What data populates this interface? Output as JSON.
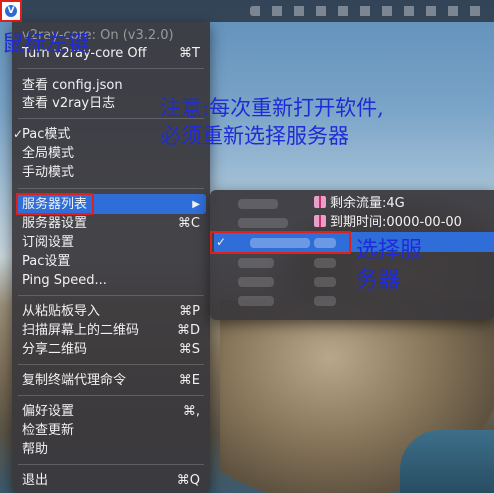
{
  "menubar": {
    "app_icon": "v2ray-app-icon"
  },
  "menu": {
    "header": "v2ray-core: On (v3.2.0)",
    "header_left": "v2ray-core: On",
    "version": "(v3.2.0)",
    "turn_off": "Turn v2ray-core Off",
    "turn_off_shortcut": "⌘T",
    "view_config": "查看 config.json",
    "view_log": "查看 v2ray日志",
    "pac_mode": "Pac模式",
    "global_mode": "全局模式",
    "manual_mode": "手动模式",
    "server_list": "服务器列表",
    "server_list_arrow": "▶",
    "server_settings": "服务器设置",
    "server_settings_shortcut": "⌘C",
    "subscription": "订阅设置",
    "pac_settings": "Pac设置",
    "ping_speed": "Ping Speed...",
    "import_clipboard": "从粘贴板导入",
    "import_clipboard_shortcut": "⌘P",
    "scan_qr": "扫描屏幕上的二维码",
    "scan_qr_shortcut": "⌘D",
    "share_qr": "分享二维码",
    "share_qr_shortcut": "⌘S",
    "copy_proxy_cmd": "复制终端代理命令",
    "copy_proxy_cmd_shortcut": "⌘E",
    "preferences": "偏好设置",
    "preferences_shortcut": "⌘,",
    "check_update": "检查更新",
    "help": "帮助",
    "quit": "退出",
    "quit_shortcut": "⌘Q",
    "checkmark": "✓"
  },
  "submenu": {
    "remaining_traffic": "剩余流量:4G",
    "expire_time": "到期时间:0000-00-00",
    "checkmark": "✓"
  },
  "annotations": {
    "left_click": "鼠标左键",
    "notice_line1": "注意:每次重新打开软件,",
    "notice_line2": "必须重新选择服务器",
    "select_server_line1": "选择服",
    "select_server_line2": "务器"
  },
  "colors": {
    "highlight": "#2f6ed8",
    "annotation": "#1f2bd6",
    "marker": "#e0201c"
  }
}
